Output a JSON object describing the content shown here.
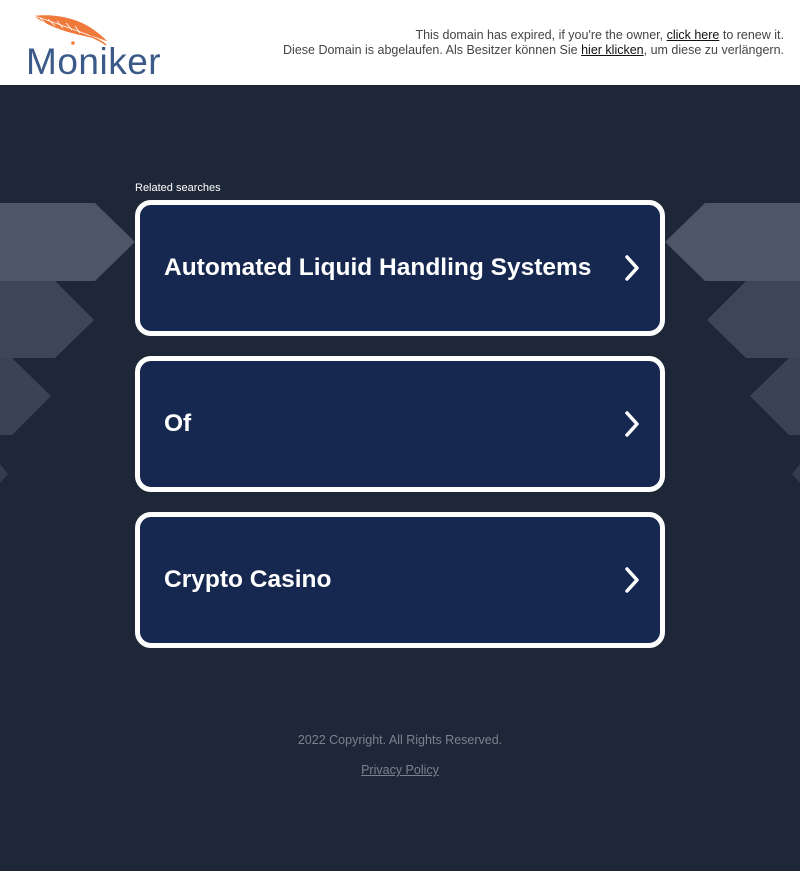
{
  "header": {
    "logo_text": "Moniker",
    "notice_en_prefix": "This domain has expired, if you're the owner, ",
    "notice_en_link": "click here",
    "notice_en_suffix": " to renew it.",
    "notice_de_prefix": "Diese Domain is abgelaufen. Als Besitzer können Sie ",
    "notice_de_link": "hier klicken",
    "notice_de_suffix": ", um diese zu verlängern."
  },
  "main": {
    "related_label": "Related searches",
    "searches": [
      {
        "label": "Automated Liquid Handling Systems",
        "icon": "chevron-right-icon"
      },
      {
        "label": "Of",
        "icon": "chevron-right-icon"
      },
      {
        "label": "Crypto Casino",
        "icon": "chevron-right-icon"
      }
    ]
  },
  "footer": {
    "copyright": "2022 Copyright. All Rights Reserved.",
    "privacy_link": "Privacy Policy"
  },
  "colors": {
    "background": "#1e2738",
    "card": "#16284f",
    "logo": "#3b5a8a",
    "feather": "#f07a3c"
  }
}
